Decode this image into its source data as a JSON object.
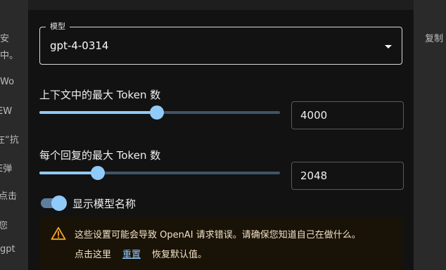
{
  "background": {
    "left_fragments": [
      "安",
      "中。",
      "Wo",
      "EW",
      "在“抗",
      "E弹",
      "点击",
      "您",
      "gpt"
    ],
    "right_fragments": [
      "复制"
    ]
  },
  "model_select": {
    "legend": "模型",
    "value": "gpt-4-0314"
  },
  "context_tokens": {
    "label": "上下文中的最大 Token 数",
    "value": "4000",
    "fraction": 0.487
  },
  "reply_tokens": {
    "label": "每个回复的最大 Token 数",
    "value": "2048",
    "fraction": 0.243
  },
  "show_model_name": {
    "label": "显示模型名称",
    "checked": true
  },
  "warning": {
    "text": "这些设置可能会导致 OpenAI 请求错误。请确保您知道自己在做什么。",
    "prefix": "点击这里",
    "link": "重置",
    "suffix": "恢复默认值。"
  },
  "colors": {
    "accent": "#90caf9",
    "warning_icon": "#f5a623",
    "warning_bg": "#191207"
  }
}
